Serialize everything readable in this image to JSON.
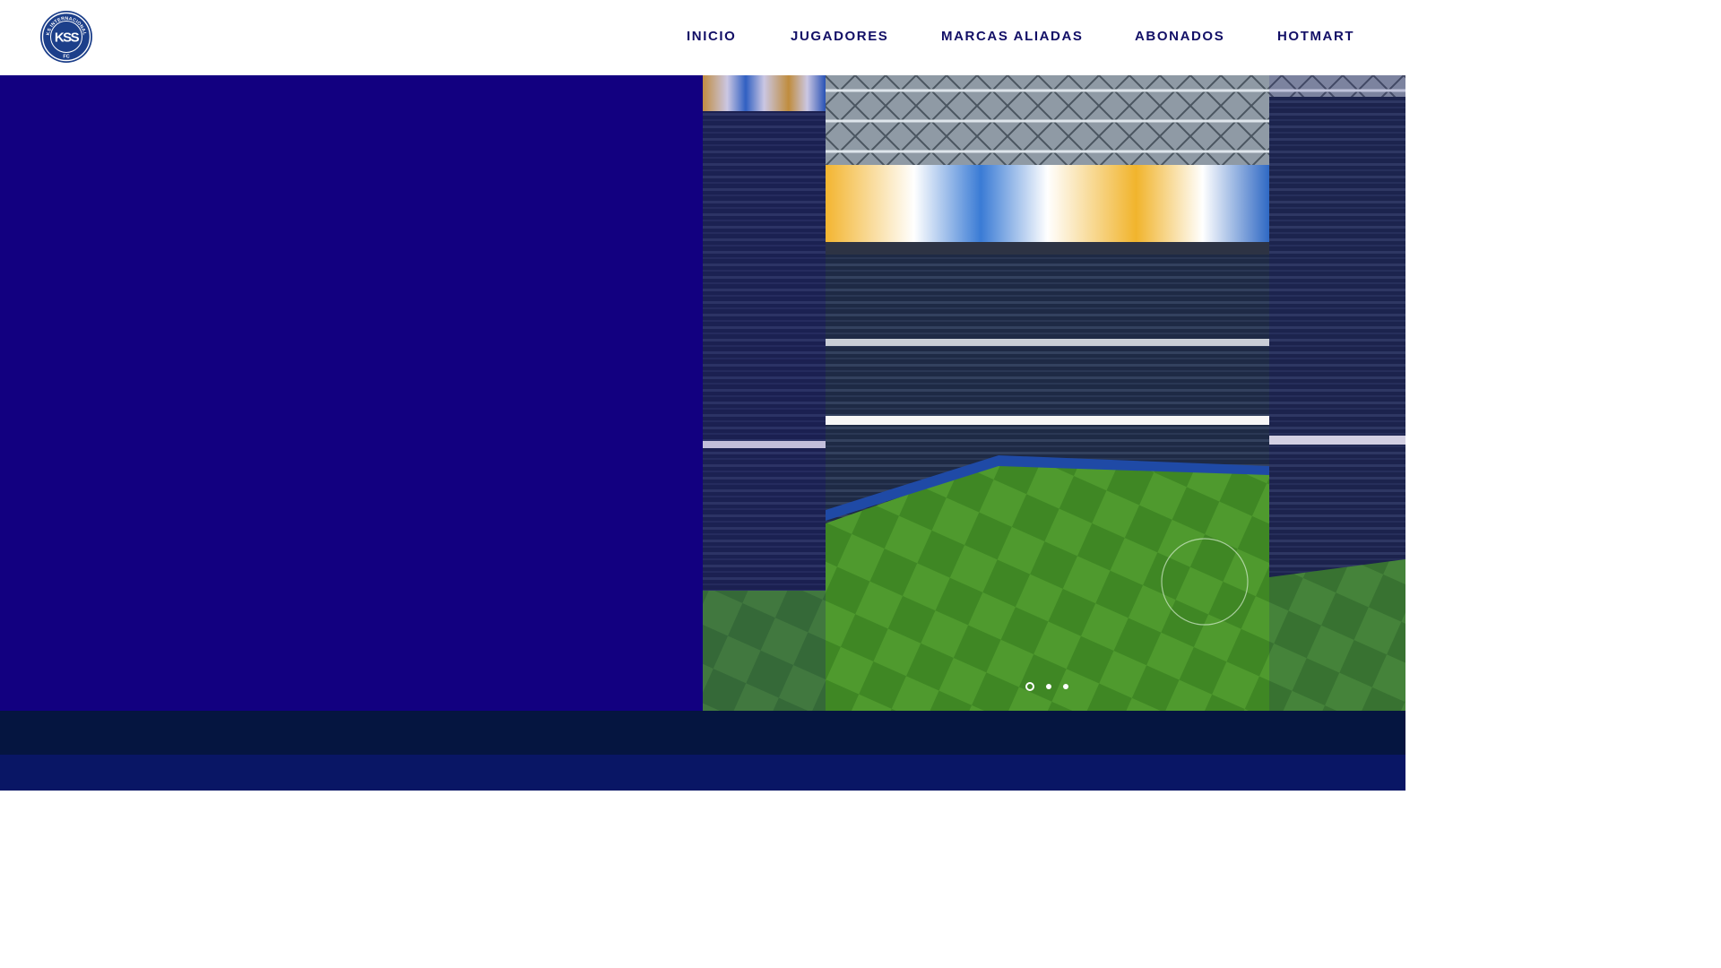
{
  "header": {
    "logo_text_top": "KS INTERNACIONAL",
    "logo_monogram": "KSS",
    "logo_text_bottom": "FC",
    "nav": [
      {
        "label": "INICIO"
      },
      {
        "label": "JUGADORES"
      },
      {
        "label": "MARCAS ALIADAS"
      },
      {
        "label": "ABONADOS"
      },
      {
        "label": "HOTMART"
      }
    ]
  },
  "hero": {
    "gallery": {
      "slide_count": 3,
      "active_slide": 1,
      "image_subject": "stadium-interior"
    }
  },
  "colors": {
    "brand_navy": "#120f66",
    "hero_blue": "#120080",
    "band_dark": "#051540",
    "band_blue": "#091665",
    "pitch_green": "#4f9a2e"
  }
}
